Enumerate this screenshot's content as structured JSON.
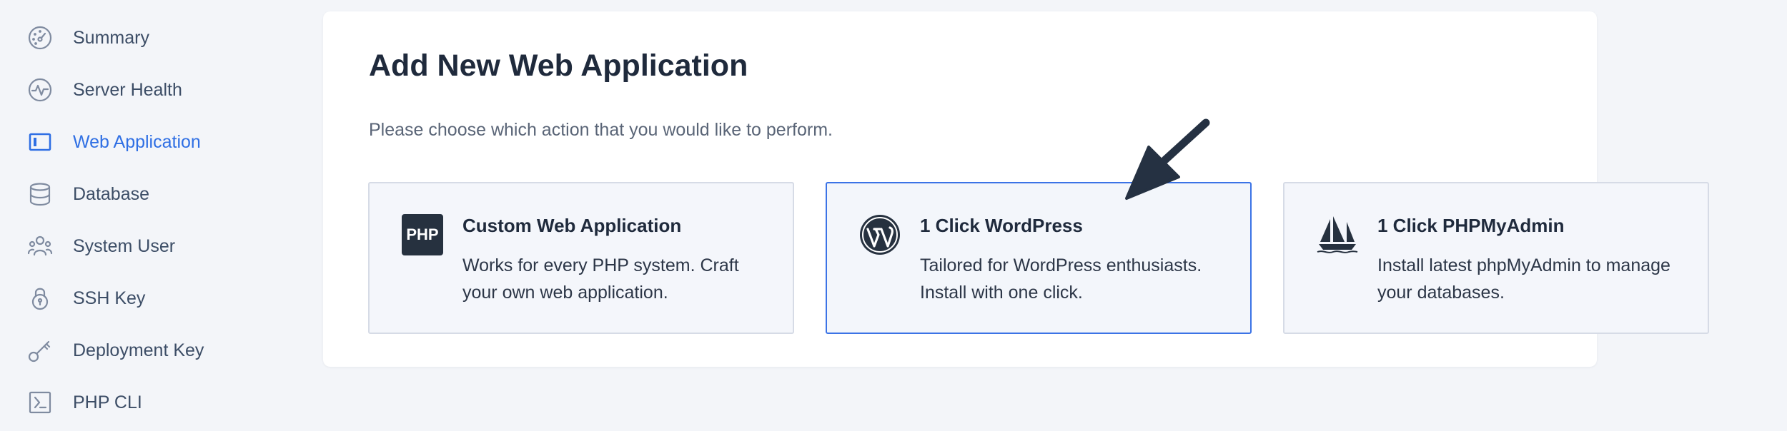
{
  "sidebar": {
    "items": [
      {
        "label": "Summary",
        "icon": "gauge-icon",
        "active": false
      },
      {
        "label": "Server Health",
        "icon": "pulse-icon",
        "active": false
      },
      {
        "label": "Web Application",
        "icon": "web-app-icon",
        "active": true
      },
      {
        "label": "Database",
        "icon": "database-icon",
        "active": false
      },
      {
        "label": "System User",
        "icon": "users-icon",
        "active": false
      },
      {
        "label": "SSH Key",
        "icon": "lock-icon",
        "active": false
      },
      {
        "label": "Deployment Key",
        "icon": "key-icon",
        "active": false
      },
      {
        "label": "PHP CLI",
        "icon": "terminal-icon",
        "active": false
      }
    ]
  },
  "main": {
    "title": "Add New Web Application",
    "subtitle": "Please choose which action that you would like to perform.",
    "cards": [
      {
        "title": "Custom Web Application",
        "description": "Works for every PHP system. Craft your own web application.",
        "icon": "php-icon",
        "icon_text": "PHP",
        "selected": false
      },
      {
        "title": "1 Click WordPress",
        "description": "Tailored for WordPress enthusiasts. Install with one click.",
        "icon": "wordpress-icon",
        "selected": true
      },
      {
        "title": "1 Click PHPMyAdmin",
        "description": "Install latest phpMyAdmin to manage your databases.",
        "icon": "phpmyadmin-icon",
        "selected": false
      }
    ]
  },
  "colors": {
    "accent": "#2f6fe4",
    "selected_border": "#3b73e6",
    "arrow": "#253142"
  }
}
